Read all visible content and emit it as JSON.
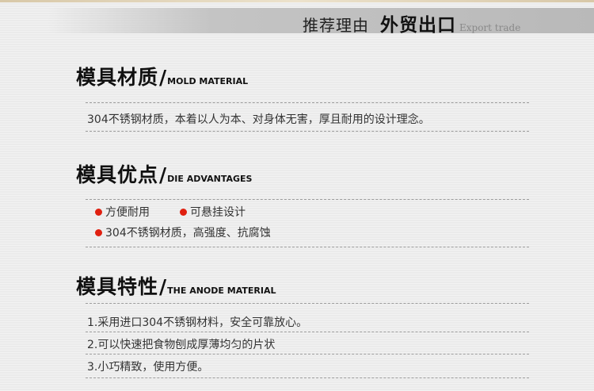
{
  "banner": {
    "subtitle": "推荐理由",
    "title": "外贸出口",
    "title_en": "Export trade"
  },
  "sections": [
    {
      "title": "模具材质",
      "title_en": "MOLD MATERIAL",
      "lines": [
        "304不锈钢材质，本着以人为本、对身体无害，厚且耐用的设计理念。"
      ]
    },
    {
      "title": "模具优点",
      "title_en": "DIE ADVANTAGES",
      "bullets": [
        "方便耐用",
        "可悬挂设计",
        "304不锈钢材质，高强度、抗腐蚀"
      ]
    },
    {
      "title": "模具特性",
      "title_en": "THE ANODE MATERIAL",
      "lines": [
        "1.采用进口304不锈钢材料，安全可靠放心。",
        "2.可以快速把食物刨成厚薄均匀的片状",
        "3.小巧精致，使用方便。"
      ]
    }
  ],
  "colors": {
    "bullet": "#e02010",
    "banner_bar": "#b9b9b9",
    "background": "#ebebeb"
  }
}
